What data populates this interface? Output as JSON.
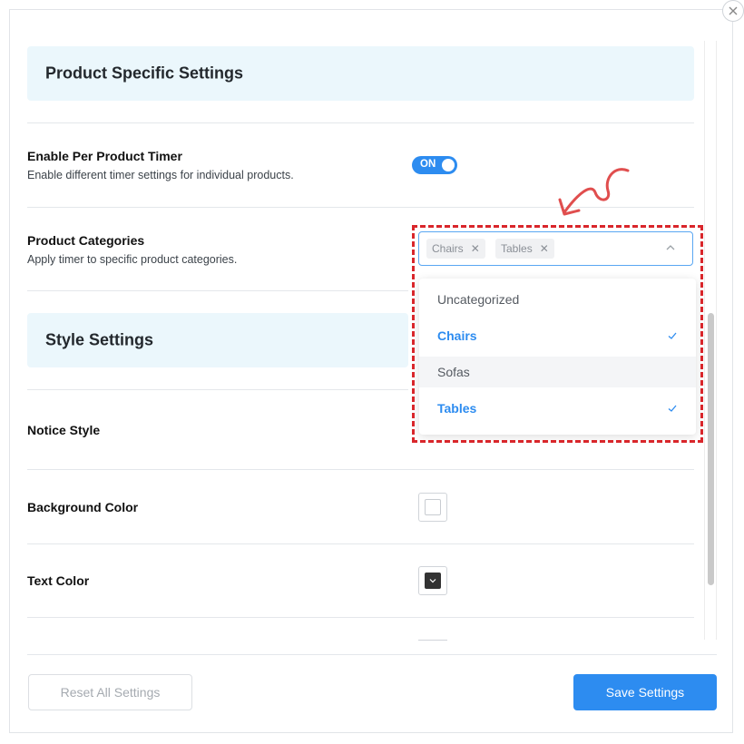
{
  "product_section": {
    "title": "Product Specific Settings",
    "per_product_timer": {
      "label": "Enable Per Product Timer",
      "description": "Enable different timer settings for individual products.",
      "toggle_text": "ON",
      "enabled": true
    },
    "categories": {
      "label": "Product Categories",
      "description": "Apply timer to specific product categories.",
      "selected_chips": [
        "Chairs",
        "Tables"
      ],
      "options": [
        {
          "label": "Uncategorized",
          "selected": false
        },
        {
          "label": "Chairs",
          "selected": true
        },
        {
          "label": "Sofas",
          "selected": false
        },
        {
          "label": "Tables",
          "selected": true
        }
      ]
    }
  },
  "style_section": {
    "title": "Style Settings",
    "notice_style": {
      "label": "Notice Style"
    },
    "background_color": {
      "label": "Background Color",
      "value": "#ffffff"
    },
    "text_color": {
      "label": "Text Color",
      "value": "#333333"
    }
  },
  "footer": {
    "reset_label": "Reset All Settings",
    "save_label": "Save Settings"
  },
  "colors": {
    "accent": "#2d8cf0",
    "section_bg": "#ebf7fc",
    "highlight": "#d9262b"
  }
}
